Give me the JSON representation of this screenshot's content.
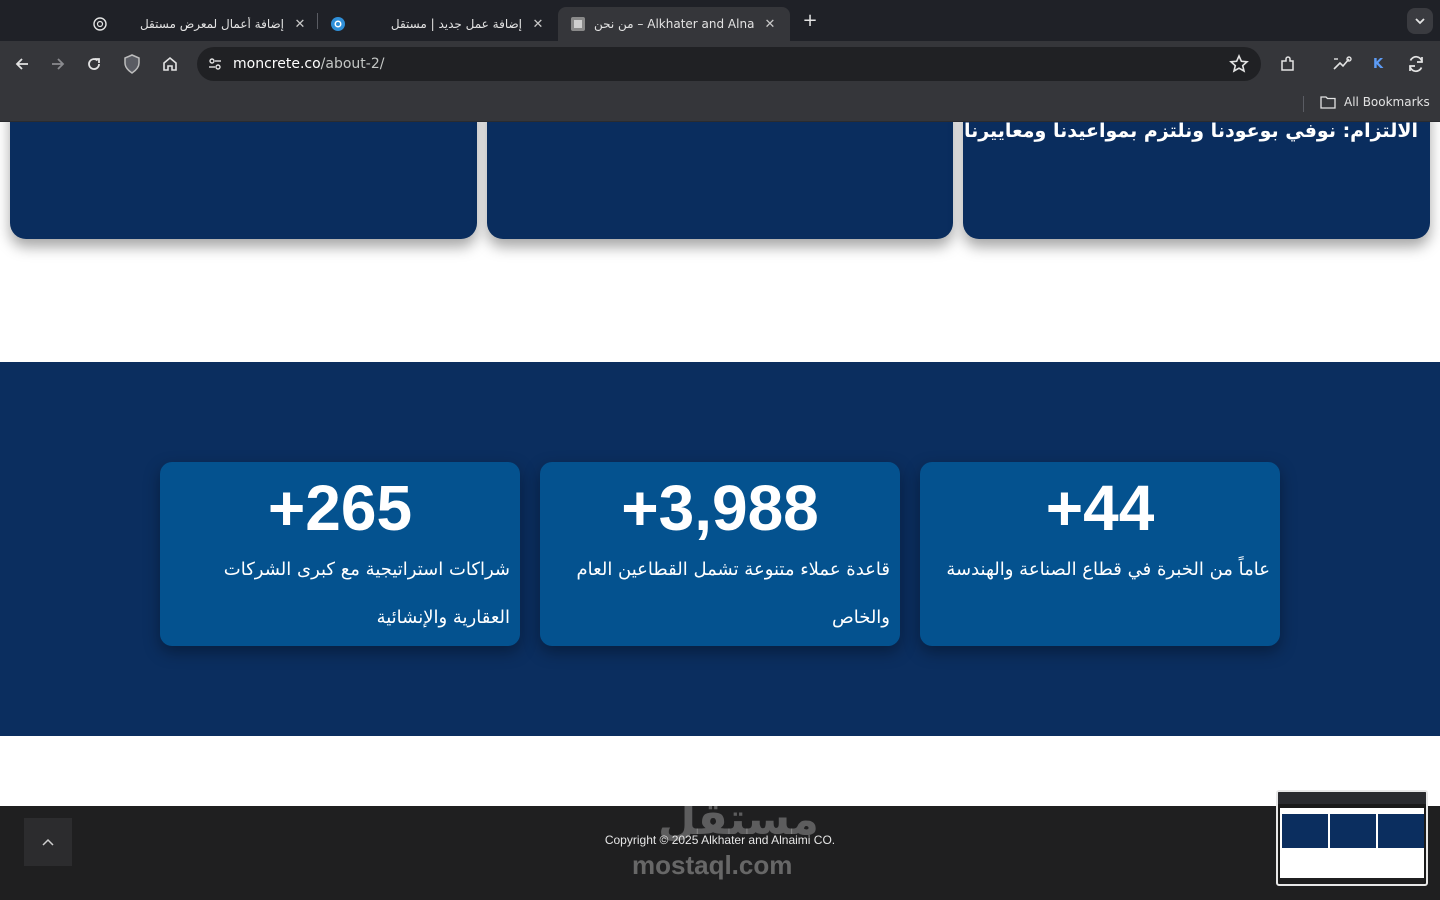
{
  "browser": {
    "tabs": [
      {
        "title": "إضافة أعمال لمعرض مستقل",
        "icon": "openai-icon",
        "active": false
      },
      {
        "title": "إضافة عمل جديد | مستقل",
        "icon": "mostaql-icon",
        "active": false
      },
      {
        "title": "من نحن – Alkhater and Alnaimi CO",
        "icon": "site-logo-icon",
        "active": true
      }
    ],
    "url_host": "moncrete.co",
    "url_path": "/about-2/",
    "profile_letter": "K",
    "bookmarks_label": "All Bookmarks"
  },
  "values_section": {
    "cards": [
      {
        "text": ""
      },
      {
        "text": ""
      },
      {
        "text": "الالتزام: نوفي بوعودنا ونلتزم بمواعيدنا ومعاييرنا"
      }
    ]
  },
  "stats_section": {
    "stats": [
      {
        "number": "+265",
        "description": "شراكات استراتيجية مع كبرى الشركات العقارية والإنشائية"
      },
      {
        "number": "+3,988",
        "description": "قاعدة عملاء متنوعة تشمل القطاعين العام والخاص"
      },
      {
        "number": "+44",
        "description": "عاماً من الخبرة في قطاع الصناعة والهندسة"
      }
    ]
  },
  "footer": {
    "copyright": "Copyright © 2025 Alkhater and Alnaimi CO.",
    "watermark_ar": "مستقل",
    "watermark_en": "mostaql.com"
  },
  "colors": {
    "navy_band": "#0b2e5f",
    "stat_card": "#04528f",
    "footer": "#1f1f20"
  }
}
